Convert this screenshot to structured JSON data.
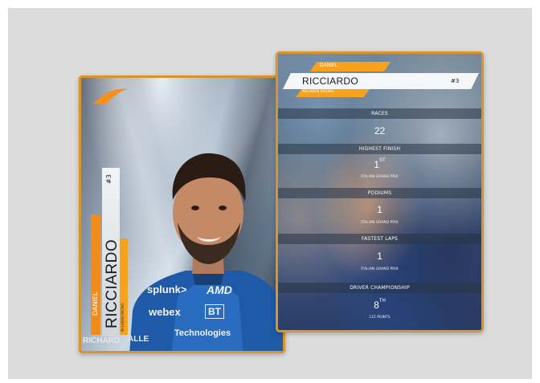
{
  "front_card": {
    "number": "#3",
    "surname": "RICCIARDO",
    "first_name": "DANIEL",
    "team": "McLAREN RACING",
    "sponsors": [
      "splunk>",
      "AMD",
      "webex",
      "BT",
      "Technologies",
      "RICHARD",
      "ALLE"
    ]
  },
  "back_card": {
    "first_name": "DANIEL",
    "surname": "RICCIARDO",
    "number": "#3",
    "team": "McLAREN RACING",
    "stats": {
      "races": {
        "label": "RACES",
        "value": "22"
      },
      "highest_finish": {
        "label": "HIGHEST FINISH",
        "value": "1",
        "suffix": "ST",
        "detail": "ITALIAN GRAND PRIX"
      },
      "podiums": {
        "label": "PODIUMS",
        "value": "1",
        "detail": "ITALIAN GRAND PRIX"
      },
      "fastest_laps": {
        "label": "FASTEST LAPS",
        "value": "1",
        "detail": "ITALIAN GRAND PRIX"
      },
      "championship": {
        "label": "DRIVER CHAMPIONSHIP",
        "value": "8",
        "suffix": "TH",
        "detail": "115 POINTS"
      }
    }
  },
  "colors": {
    "accent_orange": "#f7a21c",
    "card_border": "#d9952a",
    "background": "#dcdcdc"
  }
}
